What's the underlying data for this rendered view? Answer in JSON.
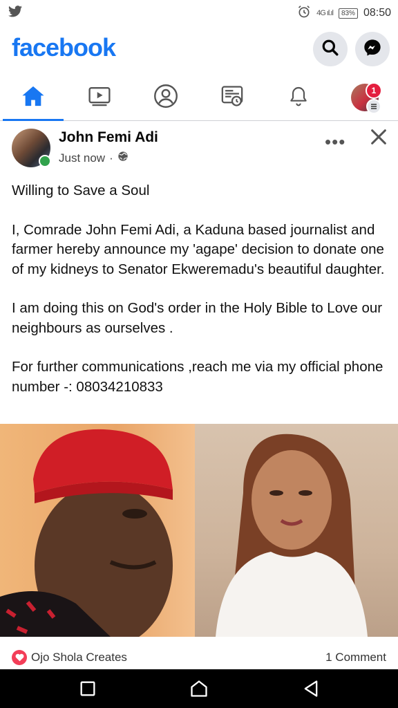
{
  "status_bar": {
    "network": "4G",
    "battery": "83%",
    "time": "08:50"
  },
  "app": {
    "logo": "facebook"
  },
  "tabs": [
    "home-icon",
    "watch-icon",
    "profile-icon",
    "news-icon",
    "notifications-icon",
    "menu-avatar"
  ],
  "menu_badge": "1",
  "post": {
    "author": "John Femi Adi",
    "time": "Just now",
    "privacy_separator": "·",
    "paragraphs": [
      "Willing to Save a Soul",
      "I, Comrade John Femi Adi, a Kaduna based journalist and farmer hereby announce my 'agape' decision to donate one of my kidneys to Senator Ekweremadu's beautiful daughter.",
      "I am doing this on God's order in the  Holy Bible to Love our neighbours as ourselves .",
      "For further communications ,reach me via my official phone number -: 08034210833"
    ],
    "reaction_name": "Ojo Shola Creates",
    "comments": "1 Comment"
  },
  "colors": {
    "brand": "#1877f2",
    "badge": "#e41e3f",
    "online": "#31a24c",
    "love": "#f33e58"
  }
}
